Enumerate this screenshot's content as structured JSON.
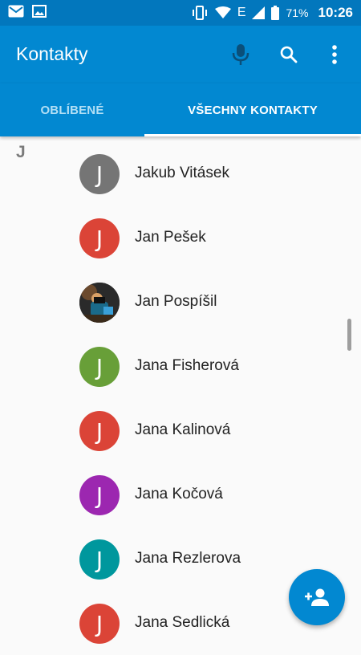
{
  "status_bar": {
    "battery": "71%",
    "time": "10:26",
    "network": "E"
  },
  "app_bar": {
    "title": "Kontakty",
    "icons": [
      "mic-icon",
      "search-icon",
      "more-vert-icon"
    ]
  },
  "tabs": [
    {
      "label": "OBLÍBENÉ",
      "selected": false
    },
    {
      "label": "VŠECHNY KONTAKTY",
      "selected": true
    }
  ],
  "section": {
    "letter": "J"
  },
  "contacts": [
    {
      "name": "Jakub Vitásek",
      "initial": "J",
      "color": "#757575",
      "photo": false
    },
    {
      "name": "Jan Pešek",
      "initial": "J",
      "color": "#db4437",
      "photo": false
    },
    {
      "name": "Jan Pospíšil",
      "initial": "",
      "color": "#1b1b1b",
      "photo": true
    },
    {
      "name": "Jana Fisherová",
      "initial": "J",
      "color": "#689f38",
      "photo": false
    },
    {
      "name": "Jana Kalinová",
      "initial": "J",
      "color": "#db4437",
      "photo": false
    },
    {
      "name": "Jana Kočová",
      "initial": "J",
      "color": "#9c27b0",
      "photo": false
    },
    {
      "name": "Jana Rezlerova",
      "initial": "J",
      "color": "#00979d",
      "photo": false
    },
    {
      "name": "Jana Sedlická",
      "initial": "J",
      "color": "#db4437",
      "photo": false
    }
  ],
  "colors": {
    "status_bar": "#0277bd",
    "app_bar": "#0288d1",
    "tab_inactive": "#b3dff5",
    "fab": "#0288d1"
  },
  "fab": {
    "icon": "add-contact-icon"
  }
}
